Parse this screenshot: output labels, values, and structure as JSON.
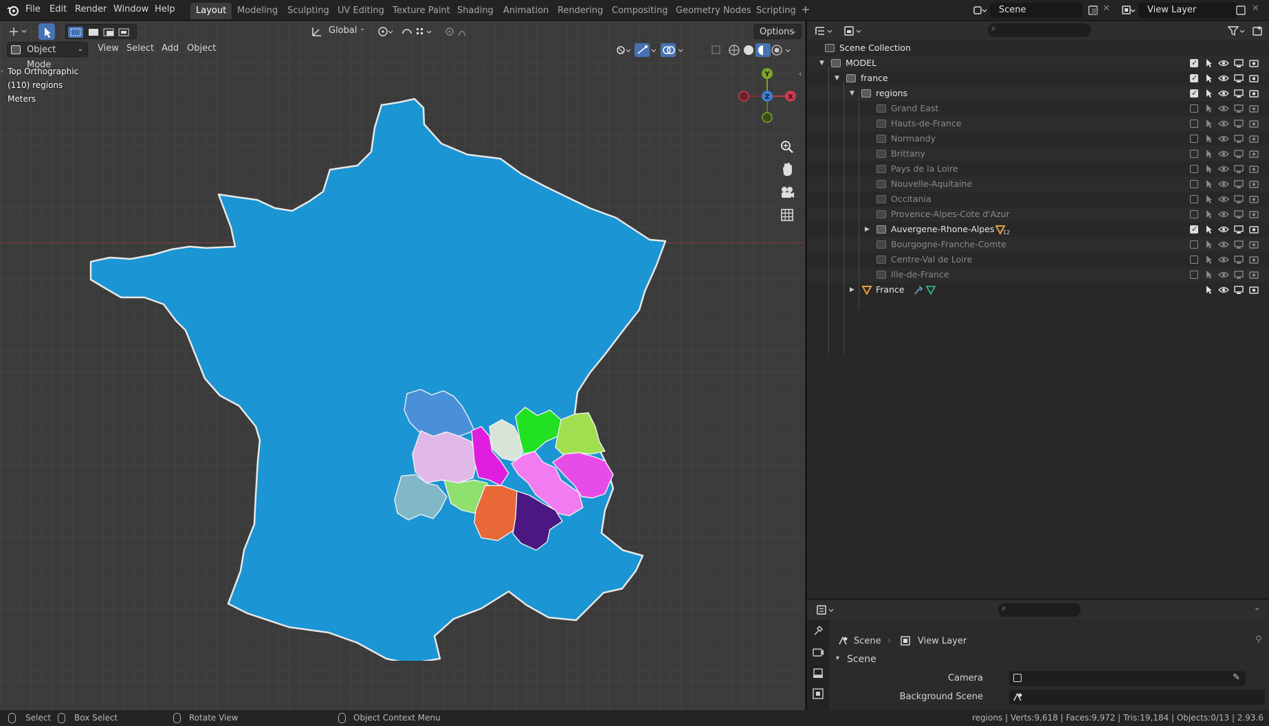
{
  "menu": [
    "File",
    "Edit",
    "Render",
    "Window",
    "Help"
  ],
  "workspaces": [
    "Layout",
    "Modeling",
    "Sculpting",
    "UV Editing",
    "Texture Paint",
    "Shading",
    "Animation",
    "Rendering",
    "Compositing",
    "Geometry Nodes",
    "Scripting"
  ],
  "active_workspace": "Layout",
  "scene_name": "Scene",
  "view_layer_name": "View Layer",
  "viewport": {
    "mode": "Object Mode",
    "menus": [
      "View",
      "Select",
      "Add",
      "Object"
    ],
    "transform_orientation": "Global",
    "options_label": "Options",
    "info_view": "Top Orthographic",
    "info_object": "(110) regions",
    "info_units": "Meters",
    "gizmo_labels": [
      "Y",
      "Z",
      "X"
    ]
  },
  "map": {
    "france_color": "#1b95d3",
    "outline_color": "#e8e8e8",
    "region_colors": [
      "#4a90d9",
      "#e0b8e8",
      "#e01ee0",
      "#d8e4d8",
      "#22e022",
      "#f07cf0",
      "#a0e050",
      "#e84ce8",
      "#80b8c8",
      "#90e070",
      "#e86838",
      "#4a1880"
    ]
  },
  "outliner": {
    "root": "Scene Collection",
    "items": [
      {
        "label": "MODEL",
        "level": 0,
        "expanded": true,
        "checked": true,
        "dim": false
      },
      {
        "label": "france",
        "level": 1,
        "expanded": true,
        "checked": true,
        "dim": false
      },
      {
        "label": "regions",
        "level": 2,
        "expanded": true,
        "checked": true,
        "dim": false
      },
      {
        "label": "Grand East",
        "level": 3,
        "checked": false,
        "dim": true
      },
      {
        "label": "Hauts-de-France",
        "level": 3,
        "checked": false,
        "dim": true
      },
      {
        "label": "Normandy",
        "level": 3,
        "checked": false,
        "dim": true
      },
      {
        "label": "Brittany",
        "level": 3,
        "checked": false,
        "dim": true
      },
      {
        "label": "Pays de la Loire",
        "level": 3,
        "checked": false,
        "dim": true
      },
      {
        "label": "Nouvelle-Aquitaine",
        "level": 3,
        "checked": false,
        "dim": true
      },
      {
        "label": "Occitania",
        "level": 3,
        "checked": false,
        "dim": true
      },
      {
        "label": "Provence-Alpes-Cote d'Azur",
        "level": 3,
        "checked": false,
        "dim": true
      },
      {
        "label": "Auvergene-Rhone-Alpes",
        "level": 3,
        "checked": true,
        "dim": false,
        "badge": "12",
        "expandable": true
      },
      {
        "label": "Bourgogne-Franche-Comte",
        "level": 3,
        "checked": false,
        "dim": true
      },
      {
        "label": "Centre-Val de Loire",
        "level": 3,
        "checked": false,
        "dim": true
      },
      {
        "label": "Ille-de-France",
        "level": 3,
        "checked": false,
        "dim": true
      },
      {
        "label": "France",
        "level": 2,
        "type": "mesh",
        "dim": false,
        "expandable": true
      }
    ]
  },
  "properties": {
    "breadcrumb": [
      "Scene",
      "View Layer"
    ],
    "panel_title": "Scene",
    "fields": [
      {
        "label": "Camera",
        "value": ""
      },
      {
        "label": "Background Scene",
        "value": ""
      }
    ]
  },
  "statusbar": {
    "select": "Select",
    "box_select": "Box Select",
    "rotate_view": "Rotate View",
    "context_menu": "Object Context Menu",
    "stats": "regions | Verts:9,618 | Faces:9,972 | Tris:19,184 | Objects:0/13 | 2.93.6"
  }
}
